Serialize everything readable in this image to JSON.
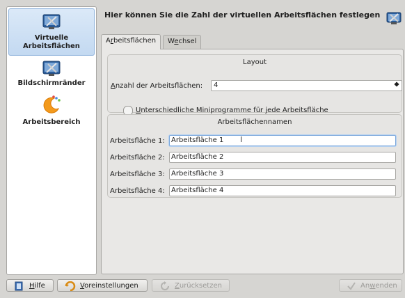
{
  "sidebar": {
    "items": [
      {
        "label": "Virtuelle Arbeitsflächen",
        "line1": "Virtuelle",
        "line2": "Arbeitsflächen",
        "icon": "virtual-desktops-icon"
      },
      {
        "label": "Bildschirmränder",
        "icon": "screen-edges-icon"
      },
      {
        "label": "Arbeitsbereich",
        "icon": "workspace-icon"
      }
    ]
  },
  "header": {
    "title": "Hier können Sie die Zahl der virtuellen Arbeitsflächen festlegen"
  },
  "tabs": [
    {
      "label_pre": "A",
      "label_u": "r",
      "label_post": "beitsflächen"
    },
    {
      "label_pre": "W",
      "label_u": "e",
      "label_post": "chsel"
    }
  ],
  "layout_group": {
    "title": "Layout",
    "count_label_pre": "",
    "count_label_u": "A",
    "count_label_post": "nzahl der Arbeitsflächen:",
    "count_value": "4",
    "checkbox_label_u": "U",
    "checkbox_label_post": "nterschiedliche Miniprogramme für jede Arbeitsfläche"
  },
  "names_group": {
    "title": "Arbeitsflächennamen",
    "rows": [
      {
        "label": "Arbeitsfläche 1:",
        "value": "Arbeitsfläche 1"
      },
      {
        "label": "Arbeitsfläche 2:",
        "value": "Arbeitsfläche 2"
      },
      {
        "label": "Arbeitsfläche 3:",
        "value": "Arbeitsfläche 3"
      },
      {
        "label": "Arbeitsfläche 4:",
        "value": "Arbeitsfläche 4"
      }
    ]
  },
  "buttons": {
    "help_u": "H",
    "help_post": "ilfe",
    "defaults_u": "V",
    "defaults_post": "oreinstellungen",
    "reset_u": "Z",
    "reset_post": "urücksetzen",
    "apply_pre": "An",
    "apply_u": "w",
    "apply_post": "enden"
  },
  "colors": {
    "accent": "#8fb3dc",
    "background": "#d6d5d2",
    "panel": "#e9e8e6"
  }
}
